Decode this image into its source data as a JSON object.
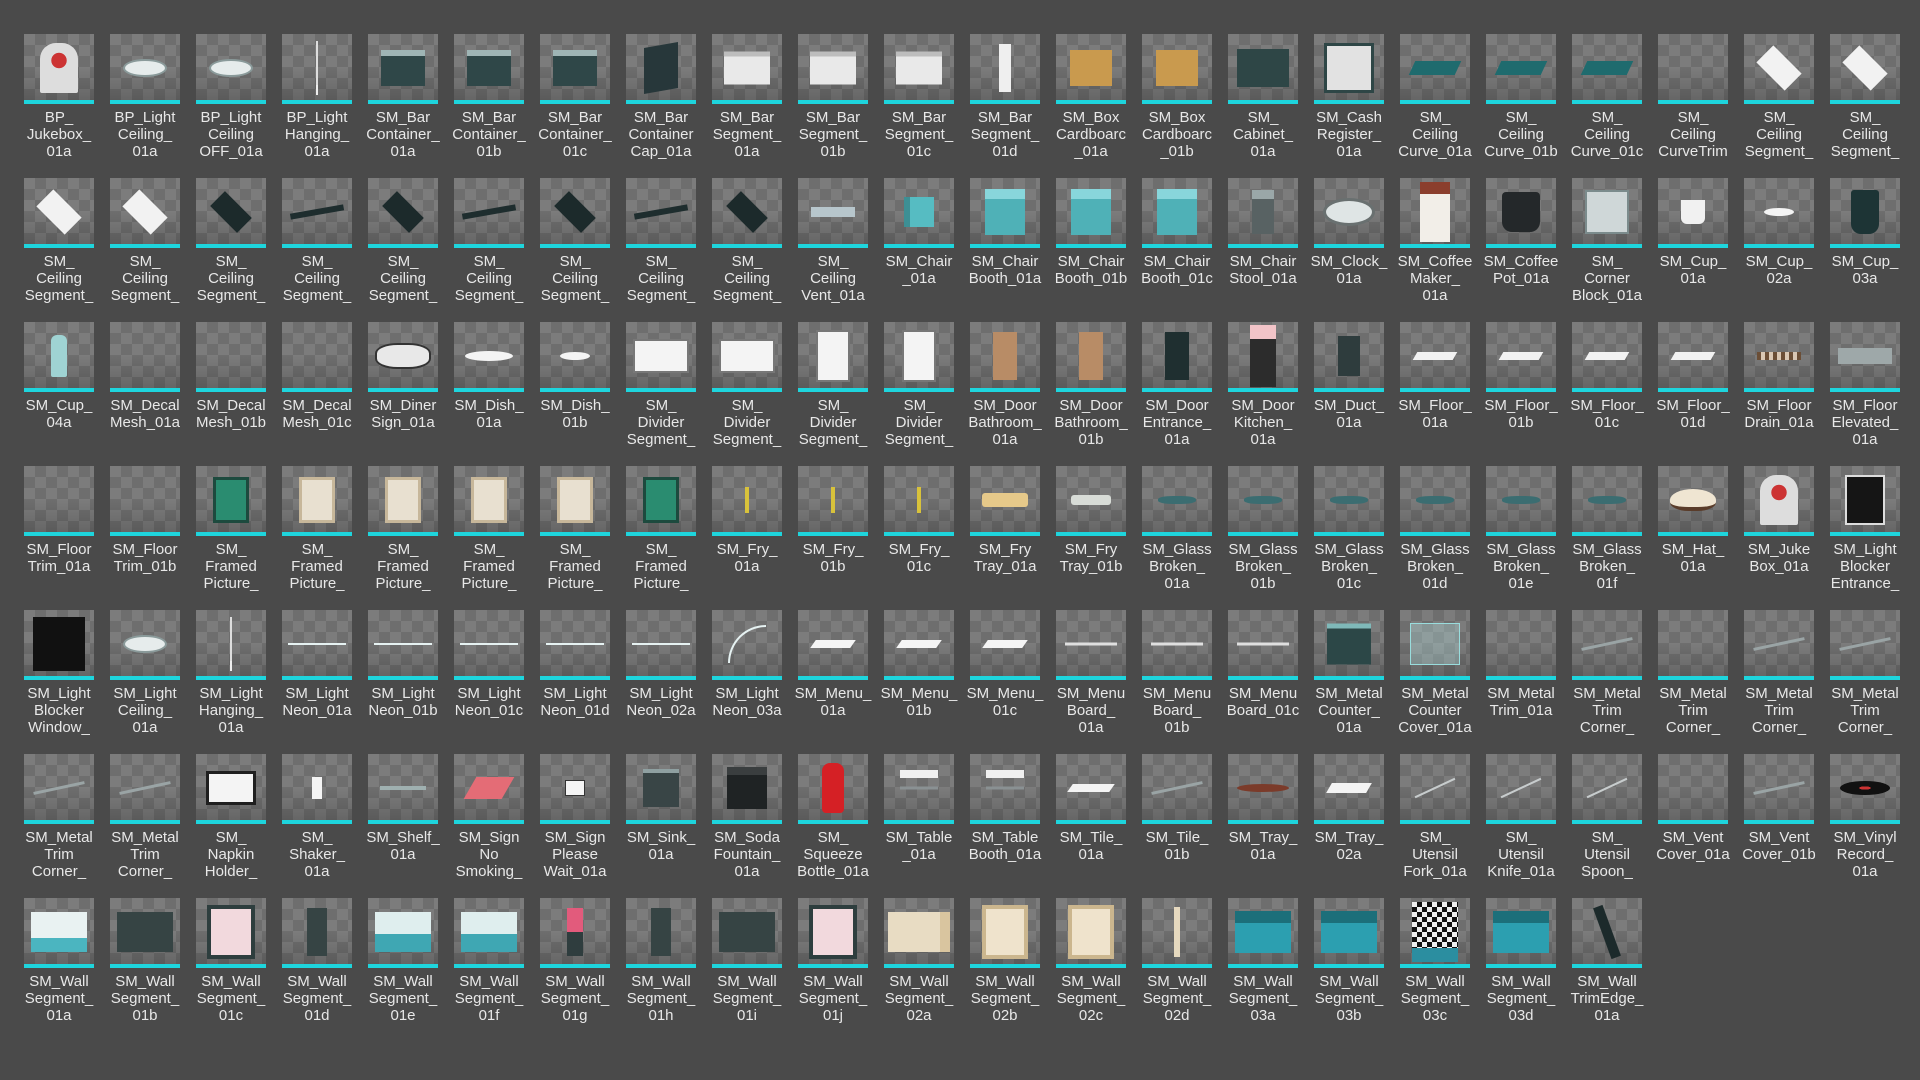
{
  "assets": [
    {
      "label": "BP_\nJukebox_\n01a",
      "icon": "jukebox-icon",
      "shape": "juke"
    },
    {
      "label": "BP_Light\nCeiling_\n01a",
      "icon": "ceiling-light-icon",
      "shape": "ceil"
    },
    {
      "label": "BP_Light\nCeiling\nOFF_01a",
      "icon": "ceiling-light-icon",
      "shape": "ceil"
    },
    {
      "label": "BP_Light\nHanging_\n01a",
      "icon": "hanging-light-icon",
      "shape": "hang"
    },
    {
      "label": "SM_Bar\nContainer_\n01a",
      "icon": "bar-container-icon",
      "shape": "box"
    },
    {
      "label": "SM_Bar\nContainer_\n01b",
      "icon": "bar-container-icon",
      "shape": "box"
    },
    {
      "label": "SM_Bar\nContainer_\n01c",
      "icon": "bar-container-icon",
      "shape": "box"
    },
    {
      "label": "SM_Bar\nContainer\nCap_01a",
      "icon": "bar-cap-icon",
      "shape": "panel"
    },
    {
      "label": "SM_Bar\nSegment_\n01a",
      "icon": "bar-segment-icon",
      "shape": "white"
    },
    {
      "label": "SM_Bar\nSegment_\n01b",
      "icon": "bar-segment-icon",
      "shape": "white"
    },
    {
      "label": "SM_Bar\nSegment_\n01c",
      "icon": "bar-segment-icon",
      "shape": "white"
    },
    {
      "label": "SM_Bar\nSegment_\n01d",
      "icon": "bar-segment-icon",
      "shape": "tall"
    },
    {
      "label": "SM_Box\nCardboarc\n_01a",
      "icon": "cardboard-box-icon",
      "shape": "card"
    },
    {
      "label": "SM_Box\nCardboarc\n_01b",
      "icon": "cardboard-box-icon",
      "shape": "card"
    },
    {
      "label": "SM_\nCabinet_\n01a",
      "icon": "cabinet-icon",
      "shape": "cab"
    },
    {
      "label": "SM_Cash\nRegister_\n01a",
      "icon": "cash-register-icon",
      "shape": "reg"
    },
    {
      "label": "SM_\nCeiling\nCurve_01a",
      "icon": "ceiling-curve-icon",
      "shape": "teal"
    },
    {
      "label": "SM_\nCeiling\nCurve_01b",
      "icon": "ceiling-curve-icon",
      "shape": "teal"
    },
    {
      "label": "SM_\nCeiling\nCurve_01c",
      "icon": "ceiling-curve-icon",
      "shape": "teal"
    },
    {
      "label": "SM_\nCeiling\nCurveTrim",
      "icon": "ceiling-trim-icon",
      "shape": "none"
    },
    {
      "label": "SM_\nCeiling\nSegment_",
      "icon": "ceiling-segment-icon",
      "shape": "diam"
    },
    {
      "label": "SM_\nCeiling\nSegment_",
      "icon": "ceiling-segment-icon",
      "shape": "diam"
    },
    {
      "label": "SM_\nCeiling\nSegment_",
      "icon": "ceiling-segment-icon",
      "shape": "diam"
    },
    {
      "label": "SM_\nCeiling\nSegment_",
      "icon": "ceiling-segment-icon",
      "shape": "diam"
    },
    {
      "label": "SM_\nCeiling\nSegment_",
      "icon": "ceiling-segment-icon",
      "shape": "dark"
    },
    {
      "label": "SM_\nCeiling\nSegment_",
      "icon": "ceiling-segment-icon",
      "shape": "flat"
    },
    {
      "label": "SM_\nCeiling\nSegment_",
      "icon": "ceiling-segment-icon",
      "shape": "dark"
    },
    {
      "label": "SM_\nCeiling\nSegment_",
      "icon": "ceiling-segment-icon",
      "shape": "flat"
    },
    {
      "label": "SM_\nCeiling\nSegment_",
      "icon": "ceiling-segment-icon",
      "shape": "dark"
    },
    {
      "label": "SM_\nCeiling\nSegment_",
      "icon": "ceiling-segment-icon",
      "shape": "flat"
    },
    {
      "label": "SM_\nCeiling\nSegment_",
      "icon": "ceiling-segment-icon",
      "shape": "dark"
    },
    {
      "label": "SM_\nCeiling\nVent_01a",
      "icon": "ceiling-vent-icon",
      "shape": "vent"
    },
    {
      "label": "SM_Chair\n_01a",
      "icon": "chair-icon",
      "shape": "chair"
    },
    {
      "label": "SM_Chair\nBooth_01a",
      "icon": "booth-chair-icon",
      "shape": "booth"
    },
    {
      "label": "SM_Chair\nBooth_01b",
      "icon": "booth-chair-icon",
      "shape": "booth"
    },
    {
      "label": "SM_Chair\nBooth_01c",
      "icon": "booth-chair-icon",
      "shape": "booth"
    },
    {
      "label": "SM_Chair\nStool_01a",
      "icon": "stool-icon",
      "shape": "stool"
    },
    {
      "label": "SM_Clock_\n01a",
      "icon": "clock-icon",
      "shape": "clock"
    },
    {
      "label": "SM_Coffee\nMaker_\n01a",
      "icon": "coffee-maker-icon",
      "shape": "cmak"
    },
    {
      "label": "SM_Coffee\nPot_01a",
      "icon": "coffee-pot-icon",
      "shape": "pot"
    },
    {
      "label": "SM_\nCorner\nBlock_01a",
      "icon": "corner-block-icon",
      "shape": "cblk"
    },
    {
      "label": "SM_Cup_\n01a",
      "icon": "cup-icon",
      "shape": "cup"
    },
    {
      "label": "SM_Cup_\n02a",
      "icon": "cup-icon",
      "shape": "dishs"
    },
    {
      "label": "SM_Cup_\n03a",
      "icon": "cup-icon",
      "shape": "cupd"
    },
    {
      "label": "SM_Cup_\n04a",
      "icon": "glass-icon",
      "shape": "glass"
    },
    {
      "label": "SM_Decal\nMesh_01a",
      "icon": "decal-icon",
      "shape": "none"
    },
    {
      "label": "SM_Decal\nMesh_01b",
      "icon": "decal-icon",
      "shape": "none"
    },
    {
      "label": "SM_Decal\nMesh_01c",
      "icon": "decal-icon",
      "shape": "none"
    },
    {
      "label": "SM_Diner\nSign_01a",
      "icon": "diner-sign-icon",
      "shape": "sign"
    },
    {
      "label": "SM_Dish_\n01a",
      "icon": "dish-icon",
      "shape": "dish"
    },
    {
      "label": "SM_Dish_\n01b",
      "icon": "dish-icon",
      "shape": "dishs"
    },
    {
      "label": "SM_\nDivider\nSegment_",
      "icon": "divider-icon",
      "shape": "div"
    },
    {
      "label": "SM_\nDivider\nSegment_",
      "icon": "divider-icon",
      "shape": "div"
    },
    {
      "label": "SM_\nDivider\nSegment_",
      "icon": "divider-icon",
      "shape": "dtall"
    },
    {
      "label": "SM_\nDivider\nSegment_",
      "icon": "divider-icon",
      "shape": "dtall"
    },
    {
      "label": "SM_Door\nBathroom_\n01a",
      "icon": "door-icon",
      "shape": "door"
    },
    {
      "label": "SM_Door\nBathroom_\n01b",
      "icon": "door-icon",
      "shape": "door"
    },
    {
      "label": "SM_Door\nEntrance_\n01a",
      "icon": "door-icon",
      "shape": "doorg"
    },
    {
      "label": "SM_Door\nKitchen_\n01a",
      "icon": "door-icon",
      "shape": "doork"
    },
    {
      "label": "SM_Duct_\n01a",
      "icon": "duct-icon",
      "shape": "duct"
    },
    {
      "label": "SM_Floor_\n01a",
      "icon": "floor-icon",
      "shape": "flr"
    },
    {
      "label": "SM_Floor_\n01b",
      "icon": "floor-icon",
      "shape": "flr"
    },
    {
      "label": "SM_Floor_\n01c",
      "icon": "floor-icon",
      "shape": "flr"
    },
    {
      "label": "SM_Floor_\n01d",
      "icon": "floor-icon",
      "shape": "flr"
    },
    {
      "label": "SM_Floor\nDrain_01a",
      "icon": "floor-drain-icon",
      "shape": "drain"
    },
    {
      "label": "SM_Floor\nElevated_\n01a",
      "icon": "floor-elevated-icon",
      "shape": "elev"
    },
    {
      "label": "SM_Floor\nTrim_01a",
      "icon": "floor-trim-icon",
      "shape": "none"
    },
    {
      "label": "SM_Floor\nTrim_01b",
      "icon": "floor-trim-icon",
      "shape": "none"
    },
    {
      "label": "SM_\nFramed\nPicture_",
      "icon": "framed-picture-icon",
      "shape": "pic"
    },
    {
      "label": "SM_\nFramed\nPicture_",
      "icon": "framed-picture-icon",
      "shape": "picw"
    },
    {
      "label": "SM_\nFramed\nPicture_",
      "icon": "framed-picture-icon",
      "shape": "picw"
    },
    {
      "label": "SM_\nFramed\nPicture_",
      "icon": "framed-picture-icon",
      "shape": "picw"
    },
    {
      "label": "SM_\nFramed\nPicture_",
      "icon": "framed-picture-icon",
      "shape": "picw"
    },
    {
      "label": "SM_\nFramed\nPicture_",
      "icon": "framed-picture-icon",
      "shape": "pic"
    },
    {
      "label": "SM_Fry_\n01a",
      "icon": "fry-icon",
      "shape": "fry"
    },
    {
      "label": "SM_Fry_\n01b",
      "icon": "fry-icon",
      "shape": "fry"
    },
    {
      "label": "SM_Fry_\n01c",
      "icon": "fry-icon",
      "shape": "fry"
    },
    {
      "label": "SM_Fry\nTray_01a",
      "icon": "fry-tray-icon",
      "shape": "tray"
    },
    {
      "label": "SM_Fry\nTray_01b",
      "icon": "fry-tray-icon",
      "shape": "trayw"
    },
    {
      "label": "SM_Glass\nBroken_\n01a",
      "icon": "broken-glass-icon",
      "shape": "brk"
    },
    {
      "label": "SM_Glass\nBroken_\n01b",
      "icon": "broken-glass-icon",
      "shape": "brk"
    },
    {
      "label": "SM_Glass\nBroken_\n01c",
      "icon": "broken-glass-icon",
      "shape": "brk"
    },
    {
      "label": "SM_Glass\nBroken_\n01d",
      "icon": "broken-glass-icon",
      "shape": "brk"
    },
    {
      "label": "SM_Glass\nBroken_\n01e",
      "icon": "broken-glass-icon",
      "shape": "brk"
    },
    {
      "label": "SM_Glass\nBroken_\n01f",
      "icon": "broken-glass-icon",
      "shape": "brk"
    },
    {
      "label": "SM_Hat_\n01a",
      "icon": "hat-icon",
      "shape": "hat"
    },
    {
      "label": "SM_Juke\nBox_01a",
      "icon": "jukebox-icon",
      "shape": "juke"
    },
    {
      "label": "SM_Light\nBlocker\nEntrance_",
      "icon": "light-blocker-icon",
      "shape": "blk"
    },
    {
      "label": "SM_Light\nBlocker\nWindow_",
      "icon": "light-blocker-icon",
      "shape": "blkw"
    },
    {
      "label": "SM_Light\nCeiling_\n01a",
      "icon": "ceiling-light-icon",
      "shape": "ceil"
    },
    {
      "label": "SM_Light\nHanging_\n01a",
      "icon": "hanging-light-icon",
      "shape": "hang"
    },
    {
      "label": "SM_Light\nNeon_01a",
      "icon": "neon-light-icon",
      "shape": "neon"
    },
    {
      "label": "SM_Light\nNeon_01b",
      "icon": "neon-light-icon",
      "shape": "neon"
    },
    {
      "label": "SM_Light\nNeon_01c",
      "icon": "neon-light-icon",
      "shape": "neon"
    },
    {
      "label": "SM_Light\nNeon_01d",
      "icon": "neon-light-icon",
      "shape": "neon"
    },
    {
      "label": "SM_Light\nNeon_02a",
      "icon": "neon-light-icon",
      "shape": "neon"
    },
    {
      "label": "SM_Light\nNeon_03a",
      "icon": "neon-light-icon",
      "shape": "neonc"
    },
    {
      "label": "SM_Menu_\n01a",
      "icon": "menu-icon",
      "shape": "menu"
    },
    {
      "label": "SM_Menu_\n01b",
      "icon": "menu-icon",
      "shape": "menu"
    },
    {
      "label": "SM_Menu_\n01c",
      "icon": "menu-icon",
      "shape": "menu"
    },
    {
      "label": "SM_Menu\nBoard_\n01a",
      "icon": "menu-board-icon",
      "shape": "menub"
    },
    {
      "label": "SM_Menu\nBoard_\n01b",
      "icon": "menu-board-icon",
      "shape": "menub"
    },
    {
      "label": "SM_Menu\nBoard_01c",
      "icon": "menu-board-icon",
      "shape": "menub"
    },
    {
      "label": "SM_Metal\nCounter_\n01a",
      "icon": "metal-counter-icon",
      "shape": "cntr"
    },
    {
      "label": "SM_Metal\nCounter\nCover_01a",
      "icon": "counter-cover-icon",
      "shape": "cntrc"
    },
    {
      "label": "SM_Metal\nTrim_01a",
      "icon": "metal-trim-icon",
      "shape": "none"
    },
    {
      "label": "SM_Metal\nTrim\nCorner_",
      "icon": "metal-trim-icon",
      "shape": "trim"
    },
    {
      "label": "SM_Metal\nTrim\nCorner_",
      "icon": "metal-trim-icon",
      "shape": "none"
    },
    {
      "label": "SM_Metal\nTrim\nCorner_",
      "icon": "metal-trim-icon",
      "shape": "trim"
    },
    {
      "label": "SM_Metal\nTrim\nCorner_",
      "icon": "metal-trim-icon",
      "shape": "trim"
    },
    {
      "label": "SM_Metal\nTrim\nCorner_",
      "icon": "metal-trim-icon",
      "shape": "trim"
    },
    {
      "label": "SM_Metal\nTrim\nCorner_",
      "icon": "metal-trim-icon",
      "shape": "trim"
    },
    {
      "label": "SM_\nNapkin\nHolder_",
      "icon": "napkin-holder-icon",
      "shape": "napk"
    },
    {
      "label": "SM_\nShaker_\n01a",
      "icon": "shaker-icon",
      "shape": "shak"
    },
    {
      "label": "SM_Shelf_\n01a",
      "icon": "shelf-icon",
      "shape": "shelf"
    },
    {
      "label": "SM_Sign\nNo\nSmoking_",
      "icon": "sign-icon",
      "shape": "sign2"
    },
    {
      "label": "SM_Sign\nPlease\nWait_01a",
      "icon": "sign-icon",
      "shape": "signw"
    },
    {
      "label": "SM_Sink_\n01a",
      "icon": "sink-icon",
      "shape": "sink"
    },
    {
      "label": "SM_Soda\nFountain_\n01a",
      "icon": "soda-fountain-icon",
      "shape": "soda"
    },
    {
      "label": "SM_\nSqueeze\nBottle_01a",
      "icon": "squeeze-bottle-icon",
      "shape": "bott"
    },
    {
      "label": "SM_Table\n_01a",
      "icon": "table-icon",
      "shape": "table"
    },
    {
      "label": "SM_Table\nBooth_01a",
      "icon": "table-icon",
      "shape": "table"
    },
    {
      "label": "SM_Tile_\n01a",
      "icon": "tile-icon",
      "shape": "tile"
    },
    {
      "label": "SM_Tile_\n01b",
      "icon": "tile-icon",
      "shape": "trim"
    },
    {
      "label": "SM_Tray_\n01a",
      "icon": "tray-icon",
      "shape": "trayr"
    },
    {
      "label": "SM_Tray_\n02a",
      "icon": "tray-icon",
      "shape": "trayw2"
    },
    {
      "label": "SM_\nUtensil\nFork_01a",
      "icon": "fork-icon",
      "shape": "uten"
    },
    {
      "label": "SM_\nUtensil\nKnife_01a",
      "icon": "knife-icon",
      "shape": "uten"
    },
    {
      "label": "SM_\nUtensil\nSpoon_",
      "icon": "spoon-icon",
      "shape": "uten"
    },
    {
      "label": "SM_Vent\nCover_01a",
      "icon": "vent-icon",
      "shape": "none"
    },
    {
      "label": "SM_Vent\nCover_01b",
      "icon": "vent-icon",
      "shape": "trim"
    },
    {
      "label": "SM_Vinyl\nRecord_\n01a",
      "icon": "vinyl-record-icon",
      "shape": "vinyl"
    },
    {
      "label": "SM_Wall\nSegment_\n01a",
      "icon": "wall-icon",
      "shape": "wall"
    },
    {
      "label": "SM_Wall\nSegment_\n01b",
      "icon": "wall-icon",
      "shape": "walld"
    },
    {
      "label": "SM_Wall\nSegment_\n01c",
      "icon": "wall-icon",
      "shape": "walla"
    },
    {
      "label": "SM_Wall\nSegment_\n01d",
      "icon": "wall-icon",
      "shape": "wallp"
    },
    {
      "label": "SM_Wall\nSegment_\n01e",
      "icon": "wall-icon",
      "shape": "wallt"
    },
    {
      "label": "SM_Wall\nSegment_\n01f",
      "icon": "wall-icon",
      "shape": "wallt"
    },
    {
      "label": "SM_Wall\nSegment_\n01g",
      "icon": "wall-icon",
      "shape": "wallk"
    },
    {
      "label": "SM_Wall\nSegment_\n01h",
      "icon": "wall-icon",
      "shape": "wallp"
    },
    {
      "label": "SM_Wall\nSegment_\n01i",
      "icon": "wall-icon",
      "shape": "walld"
    },
    {
      "label": "SM_Wall\nSegment_\n01j",
      "icon": "wall-icon",
      "shape": "walla"
    },
    {
      "label": "SM_Wall\nSegment_\n02a",
      "icon": "wall-icon",
      "shape": "wall2"
    },
    {
      "label": "SM_Wall\nSegment_\n02b",
      "icon": "wall-icon",
      "shape": "walla2"
    },
    {
      "label": "SM_Wall\nSegment_\n02c",
      "icon": "wall-icon",
      "shape": "walla2"
    },
    {
      "label": "SM_Wall\nSegment_\n02d",
      "icon": "wall-icon",
      "shape": "wallx"
    },
    {
      "label": "SM_Wall\nSegment_\n03a",
      "icon": "wall-icon",
      "shape": "wallb"
    },
    {
      "label": "SM_Wall\nSegment_\n03b",
      "icon": "wall-icon",
      "shape": "wallb"
    },
    {
      "label": "SM_Wall\nSegment_\n03c",
      "icon": "wall-icon",
      "shape": "wallc"
    },
    {
      "label": "SM_Wall\nSegment_\n03d",
      "icon": "wall-icon",
      "shape": "wallb"
    },
    {
      "label": "SM_Wall\nTrimEdge_\n01a",
      "icon": "wall-trim-edge-icon",
      "shape": "edge"
    }
  ]
}
